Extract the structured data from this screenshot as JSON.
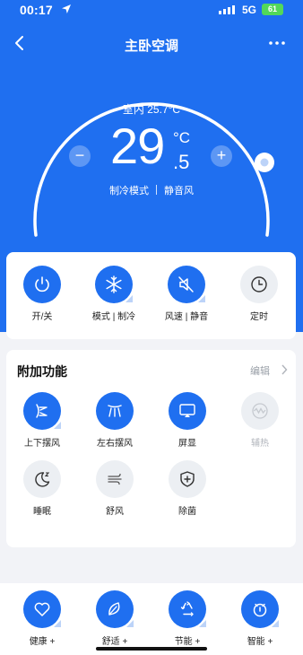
{
  "status_bar": {
    "time": "00:17",
    "network": "5G",
    "battery": "61"
  },
  "header": {
    "title": "主卧空调"
  },
  "thermostat": {
    "indoor_text": "室内 25.7°C",
    "temp_integer": "29",
    "temp_decimal": ".5",
    "temp_unit": "°C",
    "minus_label": "−",
    "plus_label": "+",
    "mode_text": "制冷模式",
    "fan_text": "静音风"
  },
  "controls": [
    {
      "label": "开/关",
      "icon": "power-icon"
    },
    {
      "label": "模式 | 制冷",
      "icon": "snowflake-icon"
    },
    {
      "label": "风速 | 静音",
      "icon": "speaker-mute-icon"
    },
    {
      "label": "定时",
      "icon": "clock-icon"
    }
  ],
  "features": {
    "title": "附加功能",
    "edit_label": "编辑",
    "items": [
      {
        "label": "上下摆风",
        "icon": "vertical-swing-icon",
        "active": true
      },
      {
        "label": "左右摆风",
        "icon": "horizontal-swing-icon",
        "active": true
      },
      {
        "label": "屏显",
        "icon": "screen-display-icon",
        "active": true
      },
      {
        "label": "辅热",
        "icon": "aux-heat-icon",
        "active": false
      },
      {
        "label": "睡眠",
        "icon": "moon-icon",
        "active": false
      },
      {
        "label": "舒风",
        "icon": "breeze-icon",
        "active": false
      },
      {
        "label": "除菌",
        "icon": "shield-plus-icon",
        "active": false
      }
    ]
  },
  "bottom_nav": [
    {
      "label": "健康 +",
      "icon": "heart-icon"
    },
    {
      "label": "舒适 +",
      "icon": "leaf-icon"
    },
    {
      "label": "节能 +",
      "icon": "recycle-icon"
    },
    {
      "label": "智能 +",
      "icon": "smart-clock-icon"
    }
  ],
  "colors": {
    "primary": "#1f6ff0",
    "background": "#f2f3f7",
    "battery": "#52d85a"
  }
}
